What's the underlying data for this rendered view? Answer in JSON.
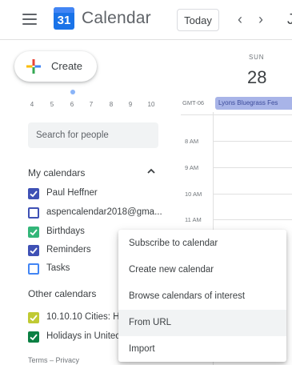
{
  "header": {
    "app_title": "Calendar",
    "logo_day": "31",
    "today_label": "Today",
    "prev_glyph": "‹",
    "next_glyph": "›",
    "month_edge": "J",
    "icons": [
      "menu-icon",
      "calendar-logo-icon",
      "chevron-left-icon",
      "chevron-right-icon"
    ]
  },
  "create": {
    "label": "Create",
    "icon": "plus-icon"
  },
  "mini_calendar": {
    "days": [
      "4",
      "5",
      "6",
      "7",
      "8",
      "9",
      "10"
    ]
  },
  "search": {
    "placeholder": "Search for people"
  },
  "my_calendars": {
    "title": "My calendars",
    "items": [
      {
        "label": "Paul Heffner",
        "checked": true,
        "color": "#3f51b5"
      },
      {
        "label": "aspencalendar2018@gma...",
        "checked": false,
        "color": "#3f51b5"
      },
      {
        "label": "Birthdays",
        "checked": true,
        "color": "#33b679"
      },
      {
        "label": "Reminders",
        "checked": true,
        "color": "#3f51b5"
      },
      {
        "label": "Tasks",
        "checked": false,
        "color": "#4285f4"
      }
    ]
  },
  "other_calendars": {
    "title": "Other calendars",
    "items": [
      {
        "label": "10.10.10 Cities: H",
        "checked": true,
        "color": "#c0ca33"
      },
      {
        "label": "Holidays in Unitec",
        "checked": true,
        "color": "#0b8043"
      }
    ]
  },
  "footer": {
    "terms": "Terms",
    "separator": "–",
    "privacy": "Privacy"
  },
  "day_view": {
    "day_name": "SUN",
    "day_number": "28",
    "timezone": "GMT-06",
    "all_day_event": "Lyons Bluegrass Fes",
    "hours": [
      "8 AM",
      "9 AM",
      "10 AM",
      "11 AM"
    ]
  },
  "menu": {
    "items": [
      "Subscribe to calendar",
      "Create new calendar",
      "Browse calendars of interest",
      "From URL",
      "Import"
    ],
    "hovered_index": 3
  }
}
